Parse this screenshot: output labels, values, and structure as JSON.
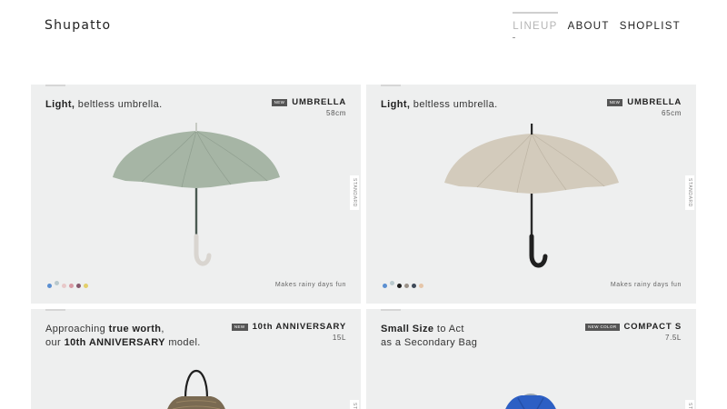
{
  "brand": {
    "logo_text": "Shupatto"
  },
  "nav": {
    "items": [
      {
        "label": "LINEUP",
        "active": true
      },
      {
        "label": "ABOUT",
        "active": false
      },
      {
        "label": "SHOPLIST",
        "active": false
      }
    ]
  },
  "cards": [
    {
      "tagline_bold": "Light,",
      "tagline_rest": " beltless umbrella.",
      "badge": "NEW",
      "product": "UMBRELLA",
      "size": "58cm",
      "side_label": "STANDARD",
      "slogan": "Makes rainy days fun",
      "canopy_color": "#a6b5a5",
      "handle_color": "#d9d5d0",
      "swatches": [
        "#5b8fd1",
        "#b9c9cd",
        "#e8c9c9",
        "#d99aa4",
        "#86586d",
        "#e3cf6a"
      ]
    },
    {
      "tagline_bold": "Light,",
      "tagline_rest": " beltless umbrella.",
      "badge": "NEW",
      "product": "UMBRELLA",
      "size": "65cm",
      "side_label": "STANDARD",
      "slogan": "Makes rainy days fun",
      "canopy_color": "#d3cbbc",
      "handle_color": "#1f1f1f",
      "swatches": [
        "#5b8fd1",
        "#b9c9cd",
        "#1d1d1d",
        "#9a9188",
        "#3f4a59",
        "#e6c6a9"
      ]
    },
    {
      "line1_pre": "Approaching ",
      "line1_bold": "true worth",
      "line1_post": ",",
      "line2_pre": "our ",
      "line2_bold": "10th ANNIVERSARY",
      "line2_post": " model.",
      "badge": "NEW",
      "product": "10th ANNIVERSARY",
      "size": "15L",
      "side_label": "ST",
      "bag_color": "#7a6a52",
      "strap_color": "#1f1f1f"
    },
    {
      "line1_bold": "Small Size",
      "line1_post": " to Act",
      "line2_pre": "as a Secondary Bag",
      "badge": "NEW COLOR",
      "product": "COMPACT S",
      "size": "7.5L",
      "side_label": "ST",
      "bag_color": "#2d5fc4",
      "strap_color": "#9aa5b0"
    }
  ]
}
